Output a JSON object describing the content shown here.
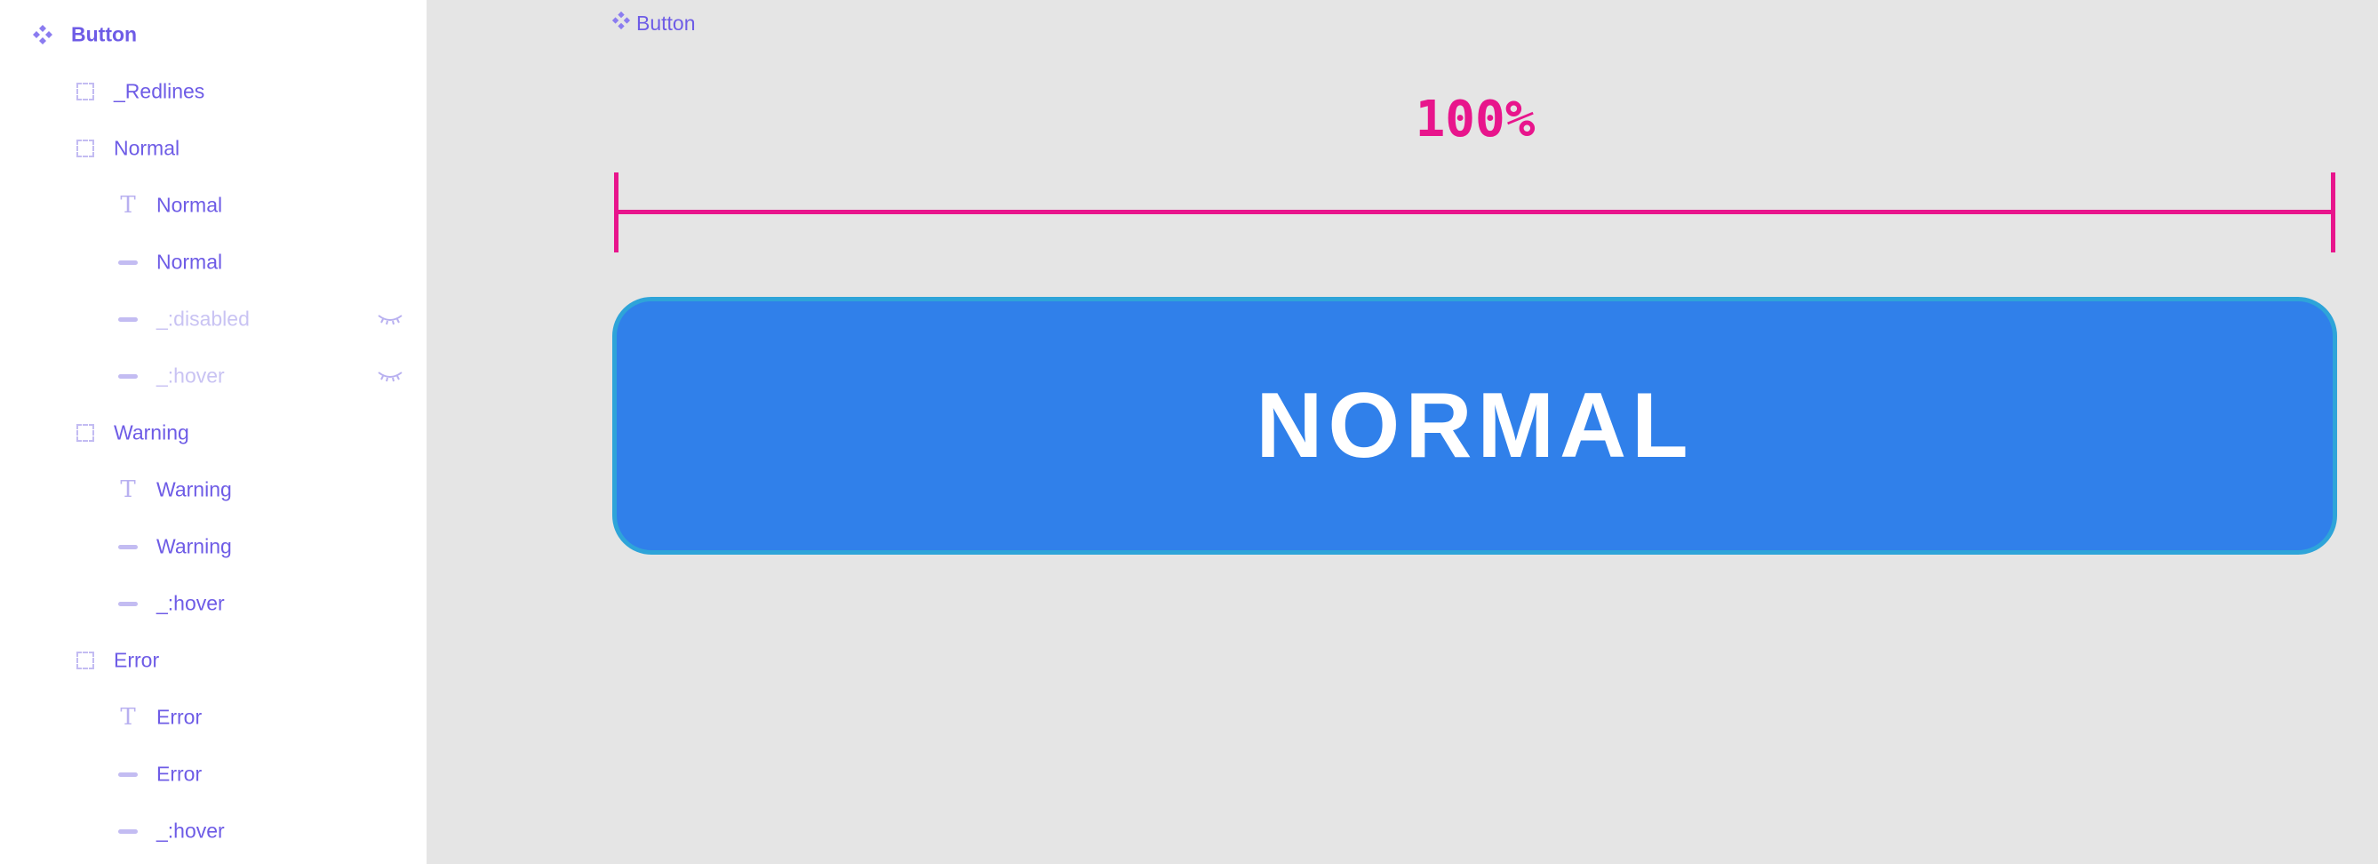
{
  "layers": {
    "root": {
      "label": "Button",
      "icon": "component-icon"
    },
    "items": [
      {
        "label": "_Redlines",
        "icon": "frame-icon",
        "hidden": false
      },
      {
        "label": "Normal",
        "icon": "frame-icon",
        "hidden": false
      },
      {
        "label": "Normal",
        "icon": "text-icon",
        "hidden": false
      },
      {
        "label": "Normal",
        "icon": "rectangle-icon",
        "hidden": false
      },
      {
        "label": "_:disabled",
        "icon": "rectangle-icon",
        "hidden": true
      },
      {
        "label": "_:hover",
        "icon": "rectangle-icon",
        "hidden": true
      },
      {
        "label": "Warning",
        "icon": "frame-icon",
        "hidden": false
      },
      {
        "label": "Warning",
        "icon": "text-icon",
        "hidden": false
      },
      {
        "label": "Warning",
        "icon": "rectangle-icon",
        "hidden": false
      },
      {
        "label": "_:hover",
        "icon": "rectangle-icon",
        "hidden": false
      },
      {
        "label": "Error",
        "icon": "frame-icon",
        "hidden": false
      },
      {
        "label": "Error",
        "icon": "text-icon",
        "hidden": false
      },
      {
        "label": "Error",
        "icon": "rectangle-icon",
        "hidden": false
      },
      {
        "label": "_:hover",
        "icon": "rectangle-icon",
        "hidden": false
      }
    ]
  },
  "canvas": {
    "frame_label": "Button",
    "redline_text": "100%",
    "button_label": "NORMAL"
  },
  "colors": {
    "accent": "#6e5ce6",
    "redline": "#e8158c",
    "button_fill": "#3080ea",
    "button_border": "#2ea4d9",
    "canvas_bg": "#e5e5e5"
  }
}
